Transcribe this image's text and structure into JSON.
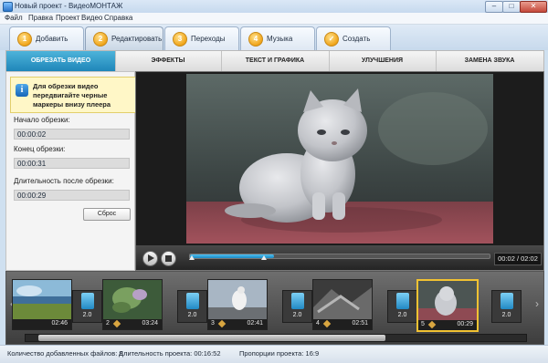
{
  "window": {
    "title": "Новый проект - ВидеоМОНТАЖ",
    "minimize": "–",
    "maximize": "□",
    "close": "✕"
  },
  "menu": [
    "Файл",
    "Правка",
    "Проект",
    "Видео",
    "Справка"
  ],
  "steps": [
    {
      "num": "1",
      "label": "Добавить"
    },
    {
      "num": "2",
      "label": "Редактировать"
    },
    {
      "num": "3",
      "label": "Переходы"
    },
    {
      "num": "4",
      "label": "Музыка"
    },
    {
      "num": "✓",
      "label": "Создать"
    }
  ],
  "subtabs": [
    "ОБРЕЗАТЬ ВИДЕО",
    "ЭФФЕКТЫ",
    "ТЕКСТ И ГРАФИКА",
    "УЛУЧШЕНИЯ",
    "ЗАМЕНА ЗВУКА"
  ],
  "trim": {
    "hint": "Для обрезки видео передвигайте черные маркеры внизу плеера",
    "start_label": "Начало обрезки:",
    "start_value": "00:00:02",
    "end_label": "Конец обрезки:",
    "end_value": "00:00:31",
    "duration_label": "Длительность после обрезки:",
    "duration_value": "00:00:29",
    "reset_label": "Сброс"
  },
  "player": {
    "time": "00:02 / 02:02",
    "progress": 0.28,
    "trim_start": 0.01,
    "trim_end": 0.25
  },
  "clips": [
    {
      "num": "",
      "duration": "02:46"
    },
    {
      "num": "2",
      "duration": "03:24"
    },
    {
      "num": "3",
      "duration": "02:41"
    },
    {
      "num": "4",
      "duration": "02:51"
    },
    {
      "num": "5",
      "duration": "00:29"
    }
  ],
  "transitions": [
    "2.0",
    "2.0",
    "2.0",
    "2.0",
    "2.0"
  ],
  "status": {
    "files": "Количество добавленных файлов: 8",
    "duration": "Длительность проекта: 00:16:52",
    "ratio": "Пропорции проекта: 16:9"
  },
  "colors": {
    "accent": "#1f86b9",
    "selected_clip": "#f1c232",
    "hint_bg": "#fff7c7"
  }
}
